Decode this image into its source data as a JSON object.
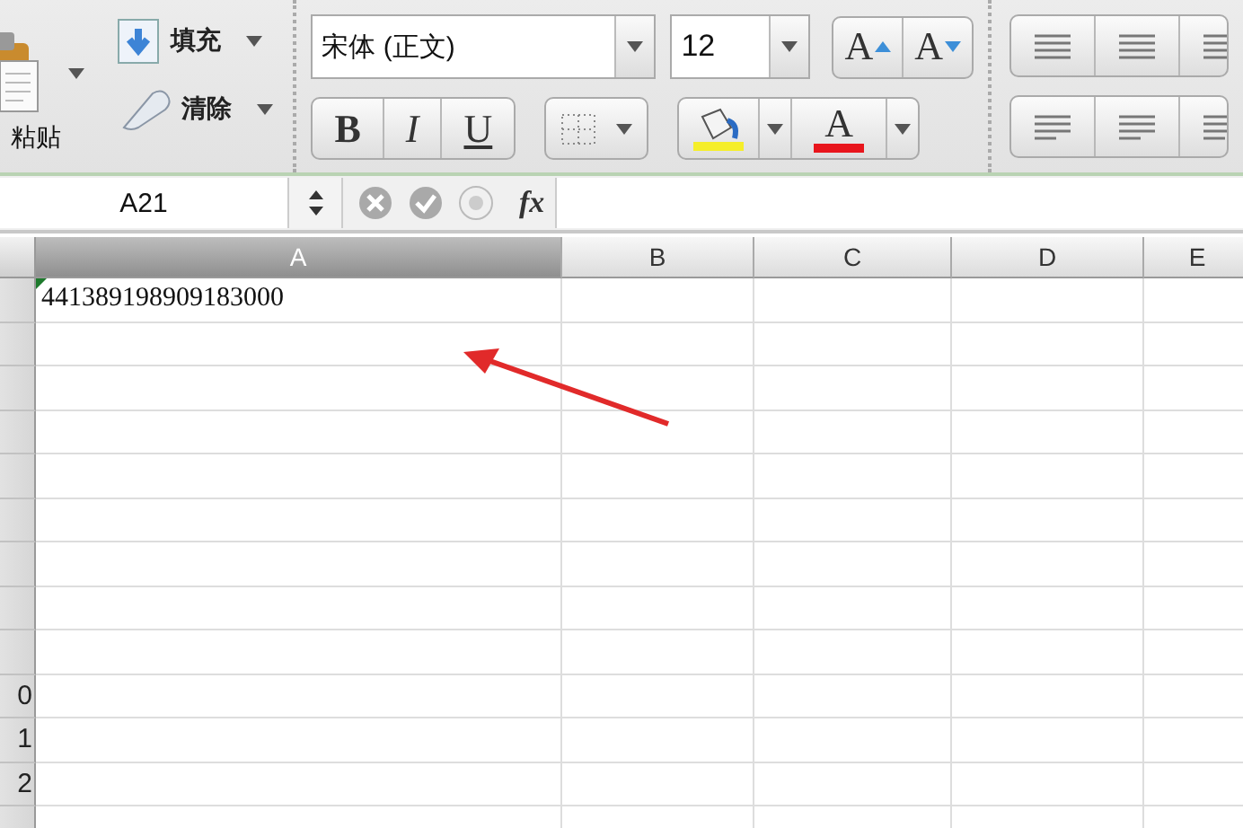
{
  "ribbon": {
    "paste": {
      "label": "粘贴"
    },
    "fill": {
      "label": "填充"
    },
    "clear": {
      "label": "清除"
    },
    "font": {
      "value": "宋体 (正文)"
    },
    "size": {
      "value": "12"
    },
    "grow": {
      "label": "A"
    },
    "shrink": {
      "label": "A"
    },
    "styles": [
      {
        "label": "B",
        "kind": "bold"
      },
      {
        "label": "I",
        "kind": "italic"
      },
      {
        "label": "U",
        "kind": "underline"
      }
    ],
    "fill_color": {
      "color": "#f5ee2a"
    },
    "font_color": {
      "label": "A",
      "color": "#e8151c"
    }
  },
  "formula_bar": {
    "name_box": "A21",
    "fx": "fx"
  },
  "sheet": {
    "columns": [
      {
        "label": "A",
        "selected": true
      },
      {
        "label": "B",
        "selected": false
      },
      {
        "label": "C",
        "selected": false
      },
      {
        "label": "D",
        "selected": false
      },
      {
        "label": "E",
        "selected": false
      }
    ],
    "rows": [
      {
        "cell": "441389198909183000",
        "flagged": true
      },
      {
        "flagged": false
      },
      {
        "flagged": false
      },
      {
        "flagged": false
      },
      {
        "flagged": false
      },
      {
        "flagged": false
      },
      {
        "flagged": false
      },
      {
        "flagged": false
      },
      {
        "flagged": false
      },
      {
        "header": "0",
        "flagged": false
      },
      {
        "header": "1",
        "flagged": false
      },
      {
        "header": "2",
        "flagged": false
      },
      {
        "flagged": false
      }
    ]
  }
}
